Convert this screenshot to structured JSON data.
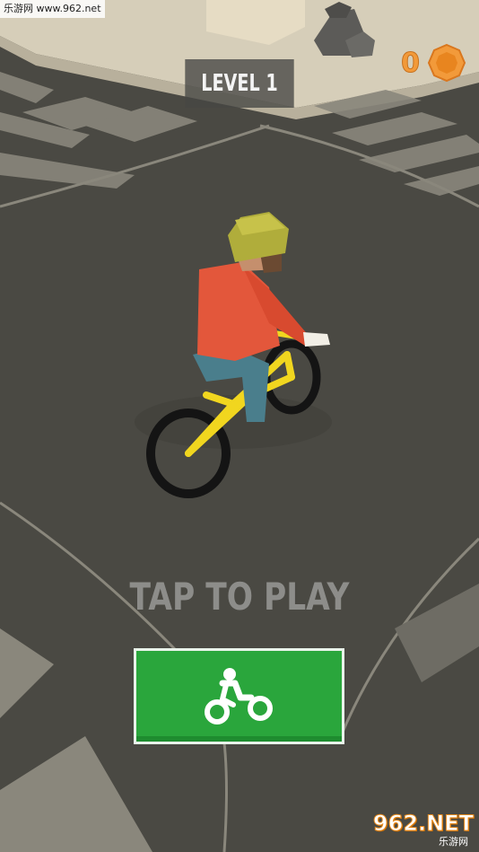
{
  "watermark_top": "乐游网 www.962.net",
  "hud": {
    "level_label": "LEVEL 1",
    "coin_count": "0",
    "coin_icon": "coin-icon",
    "coin_color": "#f29a3a"
  },
  "prompt": {
    "tap_text": "TAP TO PLAY"
  },
  "play_button": {
    "icon": "bike-icon",
    "color": "#2aa63c"
  },
  "watermark_bottom": {
    "big": "962.NET",
    "small": "乐游网"
  }
}
